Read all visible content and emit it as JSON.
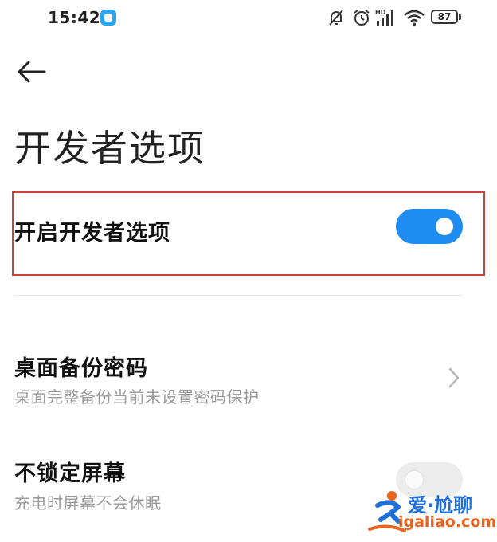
{
  "status_bar": {
    "time": "15:42",
    "battery": "87",
    "icons": [
      "app-notification-icon",
      "silent-mode-icon",
      "alarm-icon",
      "hd-signal-icon",
      "wifi-icon",
      "battery-icon"
    ]
  },
  "header": {
    "back_icon": "arrow-left-icon",
    "title": "开发者选项"
  },
  "settings": {
    "developer_toggle": {
      "title": "开启开发者选项",
      "enabled": true
    },
    "backup_password": {
      "title": "桌面备份密码",
      "subtitle": "桌面完整备份当前未设置密码保护",
      "icon": "chevron-right-icon"
    },
    "stay_awake": {
      "title": "不锁定屏幕",
      "subtitle": "充电时屏幕不会休眠",
      "enabled": false
    }
  },
  "watermark": {
    "top": "爱·尬聊",
    "bottom": "igaliao.com"
  },
  "colors": {
    "accent": "#1e8cf2",
    "highlight_border": "#c9413b",
    "subtitle": "#9a9a9a",
    "toggle_off": "#ececec"
  }
}
